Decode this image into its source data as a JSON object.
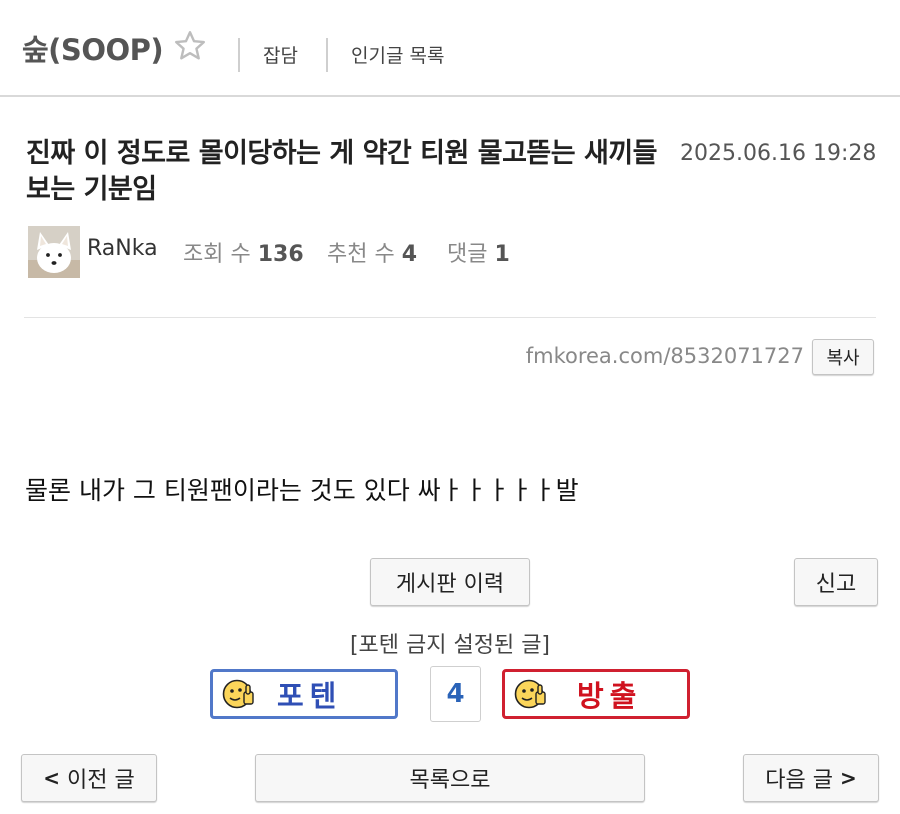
{
  "header": {
    "board_name": "숲(SOOP)",
    "nav": [
      "잡담",
      "인기글 목록"
    ]
  },
  "post": {
    "title": "진짜 이 정도로 몰이당하는 게 약간 티원 물고뜯는 새끼들 보는 기분임",
    "date": "2025.06.16 19:28",
    "author": "RaNka",
    "views_label": "조회 수",
    "views": "136",
    "likes_label": "추천 수",
    "likes": "4",
    "comments_label": "댓글",
    "comments": "1",
    "short_url": "fmkorea.com/8532071727",
    "copy_label": "복사",
    "body": "물론 내가 그 티원팬이라는 것도 있다 싸ㅏㅏㅏㅏㅏ발"
  },
  "actions": {
    "history_label": "게시판 이력",
    "report_label": "신고",
    "notice": "[포텐 금지 설정된 글]",
    "vote_up_label": "포텐",
    "vote_count": "4",
    "vote_down_label": "방출",
    "prev_label": "이전 글",
    "list_label": "목록으로",
    "next_label": "다음 글"
  },
  "colors": {
    "vote_up": "#5178c9",
    "vote_down": "#d02030",
    "vote_count": "#2a63b8"
  },
  "icons": [
    "star-icon",
    "thumbs-up-face-icon",
    "chevron-left-icon",
    "chevron-right-icon"
  ]
}
